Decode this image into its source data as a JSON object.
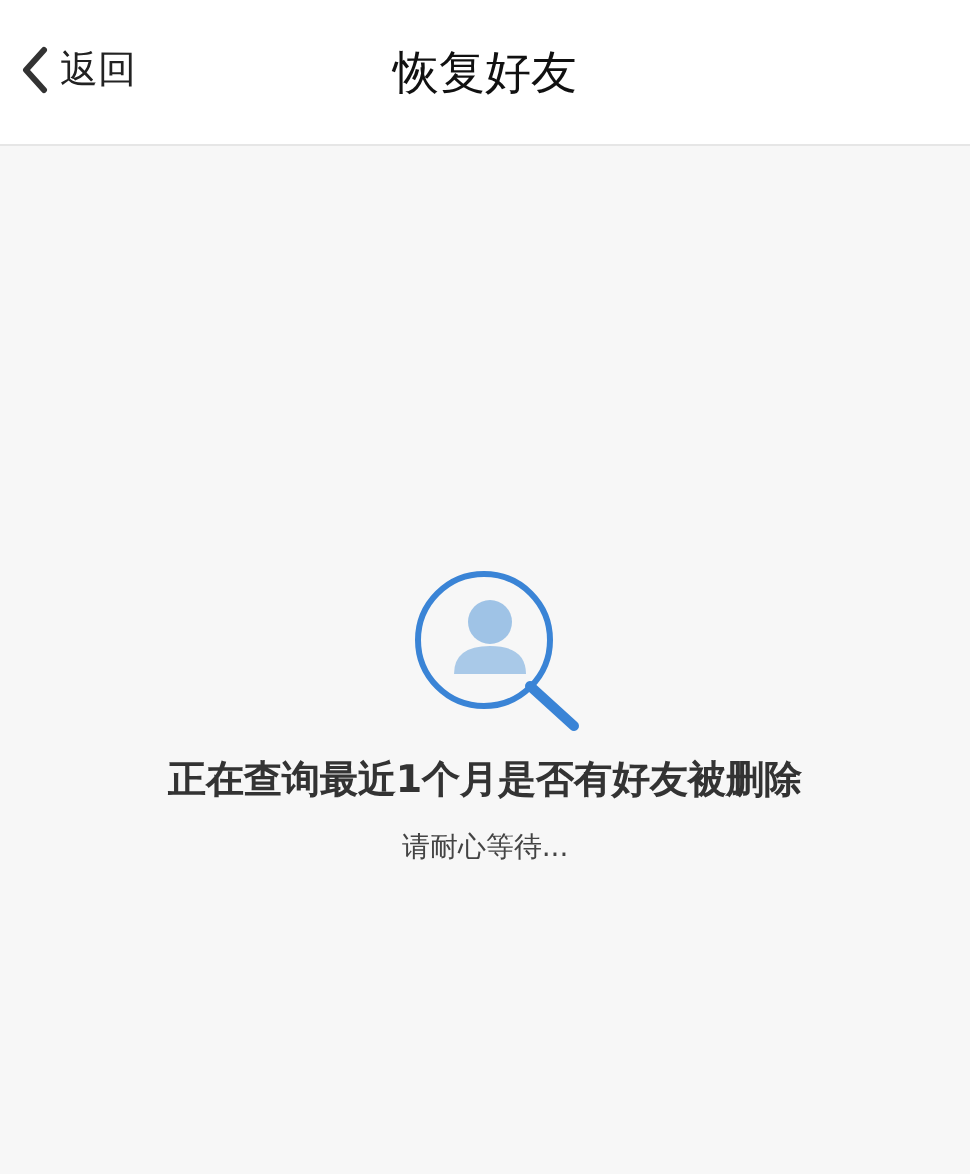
{
  "header": {
    "back_label": "返回",
    "title": "恢复好友"
  },
  "status": {
    "message": "正在查询最近1个月是否有好友被删除",
    "hint": "请耐心等待..."
  }
}
